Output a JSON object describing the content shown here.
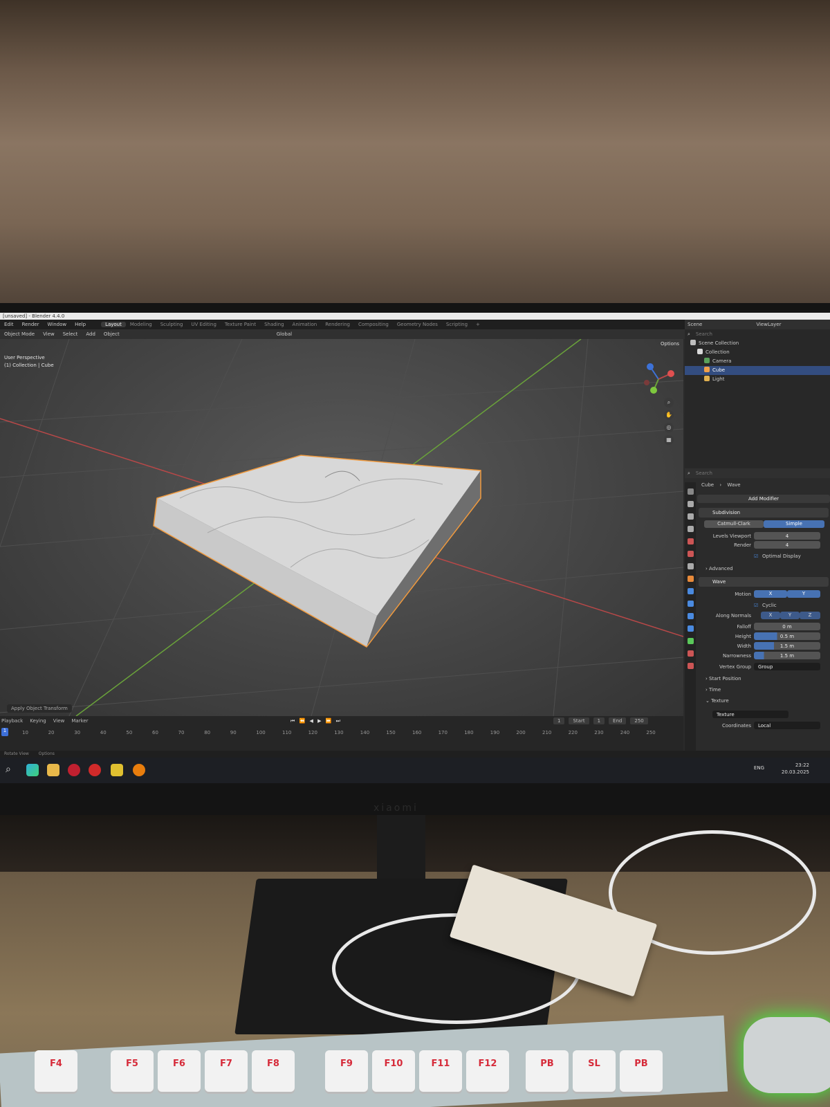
{
  "window": {
    "title": "[unsaved] - Blender 4.4.0",
    "version_corner": "4.4.0"
  },
  "menu": [
    "Edit",
    "Render",
    "Window",
    "Help"
  ],
  "workspaces": [
    {
      "label": "Layout",
      "active": true
    },
    {
      "label": "Modeling",
      "active": false
    },
    {
      "label": "Sculpting",
      "active": false
    },
    {
      "label": "UV Editing",
      "active": false
    },
    {
      "label": "Texture Paint",
      "active": false
    },
    {
      "label": "Shading",
      "active": false
    },
    {
      "label": "Animation",
      "active": false
    },
    {
      "label": "Rendering",
      "active": false
    },
    {
      "label": "Compositing",
      "active": false
    },
    {
      "label": "Geometry Nodes",
      "active": false
    },
    {
      "label": "Scripting",
      "active": false
    },
    {
      "label": "+",
      "active": false
    }
  ],
  "header3d": {
    "mode": "Object Mode",
    "view": "View",
    "select": "Select",
    "add": "Add",
    "object": "Object",
    "orientation": "Global",
    "options": "Options"
  },
  "viewport": {
    "perspective": "User Perspective",
    "context": "(1) Collection | Cube",
    "operator_panel": "Apply Object Transform"
  },
  "timeline": {
    "menus": [
      "Playback",
      "Keying",
      "View",
      "Marker"
    ],
    "current_frame": "1",
    "start_label": "Start",
    "start": "1",
    "end_label": "End",
    "end": "250",
    "ticks": [
      "10",
      "20",
      "30",
      "40",
      "50",
      "60",
      "70",
      "80",
      "90",
      "100",
      "110",
      "120",
      "130",
      "140",
      "150",
      "160",
      "170",
      "180",
      "190",
      "200",
      "210",
      "220",
      "230",
      "240",
      "250"
    ],
    "cursor": "1"
  },
  "statusbar": [
    "Rotate View",
    "Options"
  ],
  "outliner": {
    "scene_label": "Scene",
    "viewlayer_label": "ViewLayer",
    "search_placeholder": "Search",
    "items": [
      {
        "label": "Scene Collection",
        "indent": 0,
        "selected": false,
        "color": "#bdbdbd"
      },
      {
        "label": "Collection",
        "indent": 1,
        "selected": false,
        "color": "#d9d9d9"
      },
      {
        "label": "Camera",
        "indent": 2,
        "selected": false,
        "color": "#5aa05a"
      },
      {
        "label": "Cube",
        "indent": 2,
        "selected": true,
        "color": "#f0a04a"
      },
      {
        "label": "Light",
        "indent": 2,
        "selected": false,
        "color": "#e0b050"
      }
    ]
  },
  "properties": {
    "search_placeholder": "Search",
    "breadcrumb_object": "Cube",
    "breadcrumb_modifier": "Wave",
    "add_modifier": "Add Modifier",
    "subdivision": {
      "name": "Subdivision",
      "type_a": "Catmull-Clark",
      "type_b": "Simple",
      "levels_label": "Levels Viewport",
      "levels": "4",
      "render_label": "Render",
      "render": "4",
      "optimal_display": "Optimal Display",
      "advanced": "Advanced"
    },
    "wave": {
      "name": "Wave",
      "motion_label": "Motion",
      "x": "X",
      "y": "Y",
      "cyclic": "Cyclic",
      "along_normals_label": "Along Normals",
      "nx": "X",
      "ny": "Y",
      "nz": "Z",
      "falloff_label": "Falloff",
      "falloff": "0 m",
      "height_label": "Height",
      "height": "0.5 m",
      "height_fill": 0.35,
      "width_label": "Width",
      "width": "1.5 m",
      "width_fill": 0.3,
      "narrowness_label": "Narrowness",
      "narrowness": "1.5 m",
      "narrowness_fill": 0.15,
      "vertex_group_label": "Vertex Group",
      "vertex_group": "Group",
      "start_position": "Start Position",
      "time": "Time",
      "texture_section": "Texture",
      "texture_label": "Texture",
      "coordinates_label": "Coordinates",
      "coordinates": "Local"
    }
  },
  "taskbar": {
    "lang": "ENG",
    "time": "23:22",
    "date": "20.03.2025"
  },
  "monitor_brand": "xiaomi",
  "keyboard_keys": [
    "F4",
    "F5",
    "F6",
    "F7",
    "F8",
    "F9",
    "F10",
    "F11",
    "F12",
    "PB",
    "SL",
    "PB"
  ],
  "colors": {
    "accent": "#4772b3",
    "selection_outline": "#f09a3e",
    "x_axis": "#b84848",
    "y_axis": "#6aa33a"
  }
}
